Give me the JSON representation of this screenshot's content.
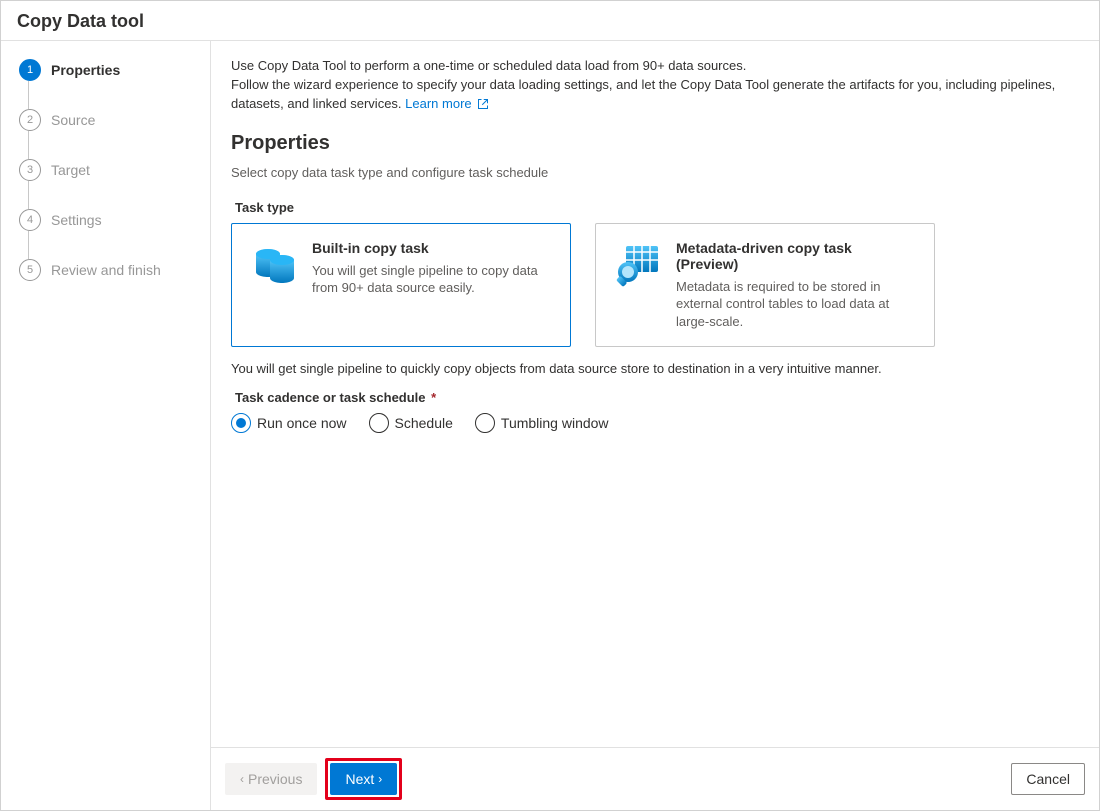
{
  "window": {
    "title": "Copy Data tool"
  },
  "sidebar": {
    "steps": [
      {
        "num": "1",
        "label": "Properties",
        "active": true
      },
      {
        "num": "2",
        "label": "Source"
      },
      {
        "num": "3",
        "label": "Target"
      },
      {
        "num": "4",
        "label": "Settings"
      },
      {
        "num": "5",
        "label": "Review and finish"
      }
    ]
  },
  "intro": {
    "line1": "Use Copy Data Tool to perform a one-time or scheduled data load from 90+ data sources.",
    "line2_a": "Follow the wizard experience to specify your data loading settings, and let the Copy Data Tool generate the artifacts for you, including pipelines, datasets, and linked services. ",
    "learn_more": "Learn more"
  },
  "page": {
    "heading": "Properties",
    "subtext": "Select copy data task type and configure task schedule"
  },
  "task_type": {
    "label": "Task type",
    "cards": [
      {
        "title": "Built-in copy task",
        "desc": "You will get single pipeline to copy data from 90+ data source easily.",
        "selected": true
      },
      {
        "title": "Metadata-driven copy task (Preview)",
        "desc": "Metadata is required to be stored in external control tables to load data at large-scale."
      }
    ],
    "note": "You will get single pipeline to quickly copy objects from data source store to destination in a very intuitive manner."
  },
  "cadence": {
    "label": "Task cadence or task schedule",
    "options": [
      {
        "label": "Run once now",
        "selected": true
      },
      {
        "label": "Schedule"
      },
      {
        "label": "Tumbling window"
      }
    ]
  },
  "footer": {
    "previous": "Previous",
    "next": "Next",
    "cancel": "Cancel"
  }
}
